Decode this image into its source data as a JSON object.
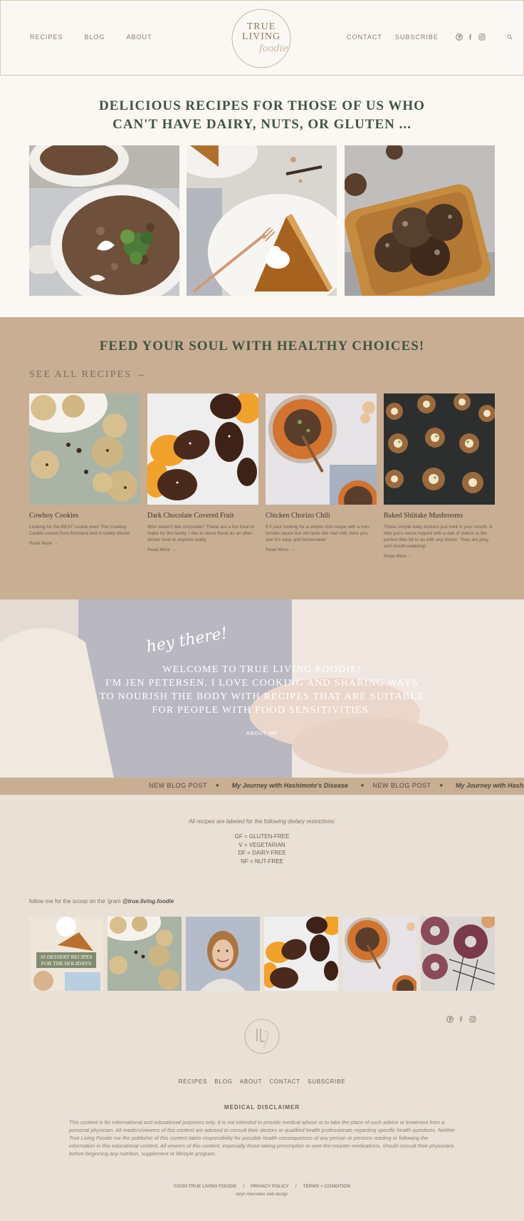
{
  "header": {
    "nav_left": [
      "RECIPES",
      "BLOG",
      "ABOUT"
    ],
    "nav_right": [
      "CONTACT",
      "SUBSCRIBE"
    ],
    "logo_line1": "TRUE",
    "logo_line2": "LIVING",
    "logo_script": "foodie",
    "social_icons": [
      "pinterest-icon",
      "facebook-icon",
      "instagram-icon"
    ],
    "search_icon": "search-icon"
  },
  "hero": {
    "title_line1": "DELICIOUS RECIPES FOR THOSE OF US WHO",
    "title_line2": "CAN'T HAVE DAIRY, NUTS, OR GLUTEN ..."
  },
  "recipes": {
    "title": "FEED YOUR SOUL WITH HEALTHY CHOICES!",
    "see_all": "SEE ALL RECIPES →",
    "cards": [
      {
        "title": "Cowboy Cookies",
        "desc": "Looking for the BEST cookie ever! The Cowboy Cookie comes from Montana and is totally divine!",
        "more": "Read More →"
      },
      {
        "title": "Dark Chocolate Covered Fruit",
        "desc": "Who doesn't like chocolate? These are a fun treat to make for the family. I like to serve these as an after-dinner treat or anytime really.",
        "more": "Read More →"
      },
      {
        "title": "Chicken Chorizo Chili",
        "desc": "If if your looking for a simple chili recipe with a non-tomato sauce but still taste like real chili, here you are! It's easy and homemade!",
        "more": "Read More →"
      },
      {
        "title": "Baked Shiitake Mushrooms",
        "desc": "These simple baby buttons just melt in your mouth. A little yuzu sauce topped with a dab of daikon is the perfect little bit to do with any dinner. They are juicy and mouth-watering!",
        "more": "Read More →"
      }
    ]
  },
  "welcome": {
    "script": "hey there!",
    "line1": "WELCOME TO TRUE LIVING FOODIE!",
    "line2": "I'M JEN PETERSEN. I LOVE COOKING AND SHARING WAYS",
    "line3": "TO NOURISH THE BODY WITH RECIPES THAT ARE SUITABLE",
    "line4": "FOR PEOPLE WITH FOOD SENSITIVITIES.",
    "button": "ABOUT ME"
  },
  "ticker": {
    "label": "NEW BLOG POST",
    "star": "✦",
    "post": "My Journey with Hashimoto's Disease"
  },
  "diet": {
    "note": "All recipes are labeled for the following dietary restrictions:",
    "items": [
      "GF = GLUTEN-FREE",
      "V = VEGETARIAN",
      "DF = DAIRY-FREE",
      "NF = NUT-FREE"
    ]
  },
  "instagram": {
    "note": "follow me for the scoop on the 'gram",
    "handle": "@true.living.foodie",
    "promo_line1": "10 DESSERT RECIPES",
    "promo_line2": "FOR THE HOLIDAYS"
  },
  "footer": {
    "nav": [
      "RECIPES",
      "BLOG",
      "ABOUT",
      "CONTACT",
      "SUBSCRIBE"
    ],
    "disclaimer_title": "MEDICAL DISCLAIMER",
    "disclaimer": "This content is for informational and educational purposes only. It is not intended to provide medical advice or to take the place of such advice or treatment from a personal physician. All readers/viewers of this content are advised to consult their doctors or qualified health professionals regarding specific health questions. Neither True Living Foodie nor the publisher of this content takes responsibility for possible health consequences of any person or persons reading or following the information in this educational content. All viewers of this content, especially those taking prescription or over-the-counter medications, should consult their physicians before beginning any nutrition, supplement or lifestyle program.",
    "copyright": "©2020 TRUE LIVING FOODIE",
    "sep": "/",
    "privacy": "PRIVACY POLICY",
    "terms": "TERMS + CONDITION",
    "credit": "taryn mercedes web design"
  }
}
